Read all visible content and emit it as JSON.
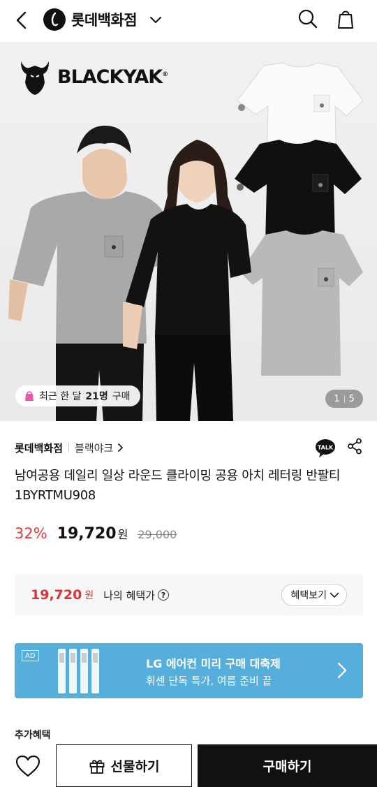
{
  "header": {
    "brand_name": "롯데백화점",
    "back_icon": "chevron-left-icon",
    "search_icon": "search-icon",
    "bag_icon": "shopping-bag-icon"
  },
  "hero": {
    "brand_logo_text": "BLACKYAK",
    "brand_logo_mark": "®",
    "buy_badge": {
      "prefix": "최근 한 달",
      "count": "21명",
      "suffix": "구매"
    },
    "pager": {
      "current": "1",
      "total": "5"
    }
  },
  "product": {
    "seller": "롯데백화점",
    "brand": "블랙야크",
    "talk_label": "TALK",
    "title": "남여공용 데일리 일상 라운드 클라이밍 공용 아치 레터링 반팔티 1BYRTMU908",
    "discount": "32%",
    "price": "19,720",
    "price_unit": "원",
    "original_price": "29,000"
  },
  "benefit": {
    "price": "19,720",
    "price_unit": "원",
    "label": "나의 혜택가",
    "help": "?",
    "button_label": "혜택보기"
  },
  "ad": {
    "tag": "AD",
    "title": "LG 에어컨 미리 구매 대축제",
    "subtitle": "휘센 단독 특가, 여름 준비 끝",
    "bg_color": "#55aedc"
  },
  "extra_benefit_label": "추가혜택",
  "bottom_bar": {
    "gift_label": "선물하기",
    "buy_label": "구매하기"
  },
  "colors": {
    "discount": "#e0393e",
    "benefit_price": "#d8353a"
  }
}
